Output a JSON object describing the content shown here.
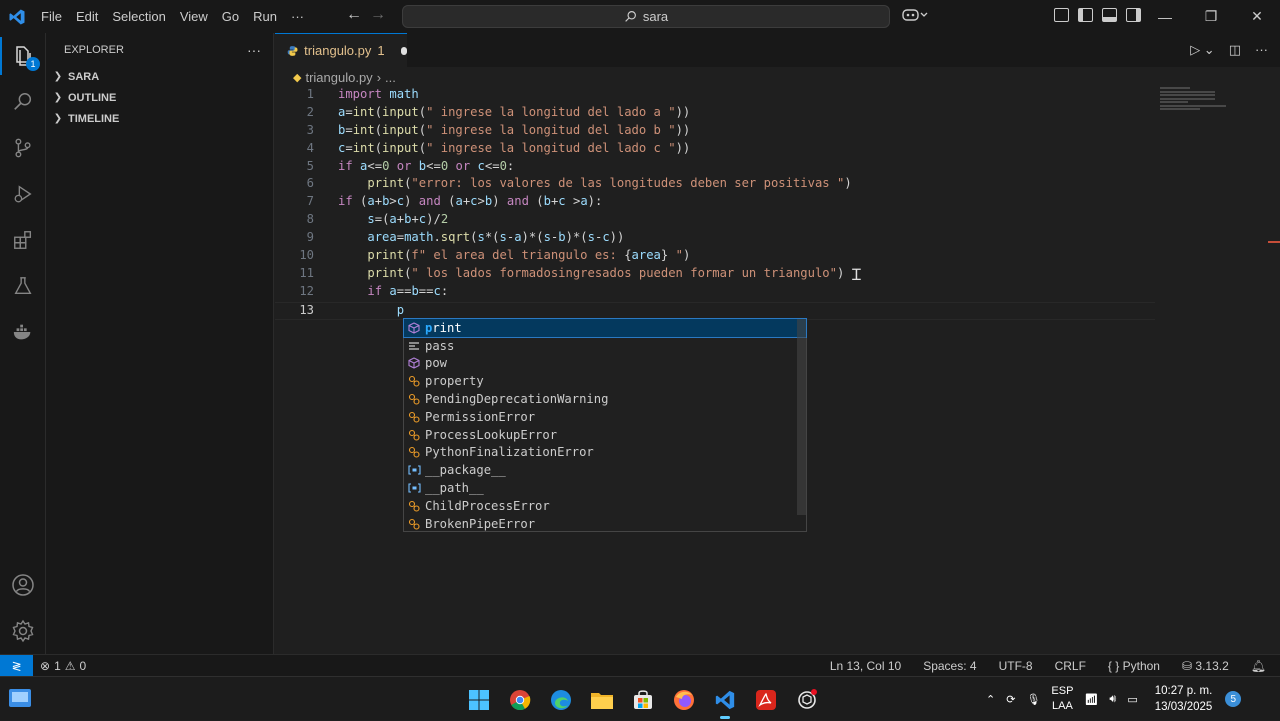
{
  "titlebar": {
    "menu": [
      "File",
      "Edit",
      "Selection",
      "View",
      "Go",
      "Run",
      "···"
    ],
    "search_text": "sara"
  },
  "sidebar": {
    "title": "EXPLORER",
    "more": "···",
    "sections": [
      "SARA",
      "OUTLINE",
      "TIMELINE"
    ]
  },
  "activity": {
    "explorer_badge": "1"
  },
  "editor": {
    "tab": {
      "filename": "triangulo.py",
      "problems": "1"
    },
    "breadcrumb": [
      "triangulo.py",
      "..."
    ],
    "line_numbers": [
      "1",
      "2",
      "3",
      "4",
      "5",
      "6",
      "7",
      "8",
      "9",
      "10",
      "11",
      "12",
      "13"
    ],
    "lines": [
      "import math",
      "a=int(input(\" ingrese la longitud del lado a \"))",
      "b=int(input(\" ingrese la longitud del lado b \"))",
      "c=int(input(\" ingrese la longitud del lado c \"))",
      "if a<=0 or b<=0 or c<=0:",
      "    print(\"error: los valores de las longitudes deben ser positivas \")",
      "if (a+b>c) and (a+c>b) and (b+c >a):",
      "    s=(a+b+c)/2",
      "    area=math.sqrt(s*(s-a)*(s-b)*(s-c))",
      "    print(f\" el area del triangulo es: {area} \")",
      "    print(\" los lados formadosingresados pueden formar un triangulo\")",
      "    if a==b==c:",
      "        p"
    ]
  },
  "suggestions": [
    {
      "match": "p",
      "rest": "rint",
      "icon": "cube-icon"
    },
    {
      "match": "",
      "rest": "pass",
      "icon": "keyword-icon"
    },
    {
      "match": "",
      "rest": "pow",
      "icon": "cube-icon"
    },
    {
      "match": "",
      "rest": "property",
      "icon": "class-icon"
    },
    {
      "match": "",
      "rest": "PendingDeprecationWarning",
      "icon": "class-icon"
    },
    {
      "match": "",
      "rest": "PermissionError",
      "icon": "class-icon"
    },
    {
      "match": "",
      "rest": "ProcessLookupError",
      "icon": "class-icon"
    },
    {
      "match": "",
      "rest": "PythonFinalizationError",
      "icon": "class-icon"
    },
    {
      "match": "",
      "rest": "__package__",
      "icon": "variable-icon"
    },
    {
      "match": "",
      "rest": "__path__",
      "icon": "variable-icon"
    },
    {
      "match": "",
      "rest": "ChildProcessError",
      "icon": "class-icon"
    },
    {
      "match": "",
      "rest": "BrokenPipeError",
      "icon": "class-icon"
    }
  ],
  "statusbar": {
    "errors": "1",
    "warnings": "0",
    "position": "Ln 13, Col 10",
    "spaces": "Spaces: 4",
    "encoding": "UTF-8",
    "eol": "CRLF",
    "language": "Python",
    "version": "3.13.2"
  },
  "taskbar": {
    "lang_line1": "ESP",
    "lang_line2": "LAA",
    "time": "10:27 p. m.",
    "date": "13/03/2025",
    "notifications": "5"
  },
  "colors": {
    "accent": "#0078d4",
    "selection": "#04395e"
  }
}
